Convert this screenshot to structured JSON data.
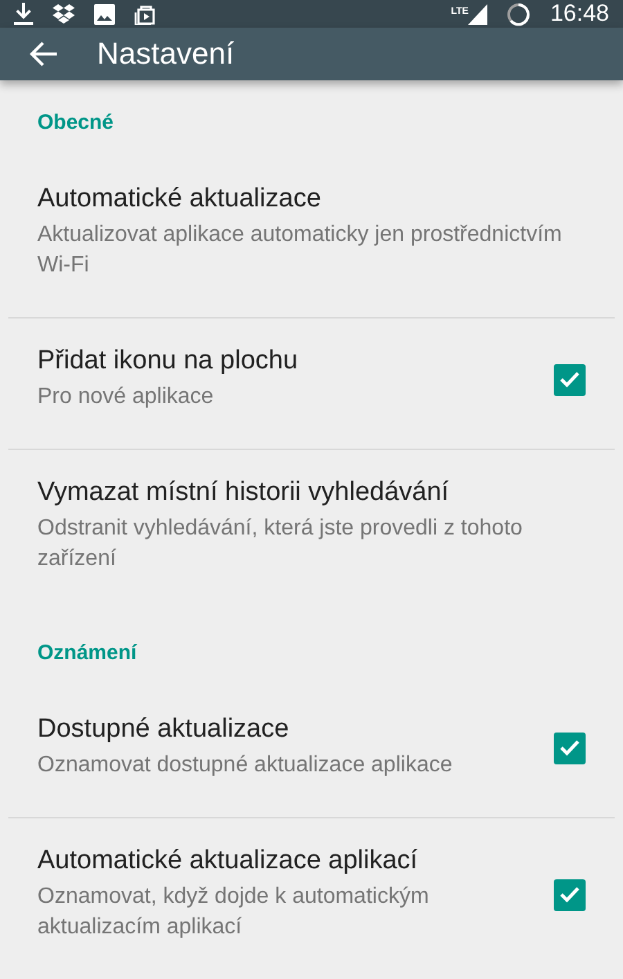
{
  "status_bar": {
    "time": "16:48",
    "network": "LTE"
  },
  "toolbar": {
    "title": "Nastavení"
  },
  "sections": [
    {
      "header": "Obecné",
      "items": [
        {
          "kind": "text",
          "title": "Automatické aktualizace",
          "subtitle": "Aktualizovat aplikace automaticky jen prostřednictvím Wi-Fi"
        },
        {
          "kind": "checkbox",
          "title": "Přidat ikonu na plochu",
          "subtitle": "Pro nové aplikace",
          "checked": true
        },
        {
          "kind": "text",
          "title": "Vymazat místní historii vyhledávání",
          "subtitle": "Odstranit vyhledávání, která jste provedli z tohoto zařízení"
        }
      ]
    },
    {
      "header": "Oznámení",
      "items": [
        {
          "kind": "checkbox",
          "title": "Dostupné aktualizace",
          "subtitle": "Oznamovat dostupné aktualizace aplikace",
          "checked": true
        },
        {
          "kind": "checkbox",
          "title": "Automatické aktualizace aplikací",
          "subtitle": "Oznamovat, když dojde k automatickým aktualizacím aplikací",
          "checked": true
        }
      ]
    }
  ]
}
